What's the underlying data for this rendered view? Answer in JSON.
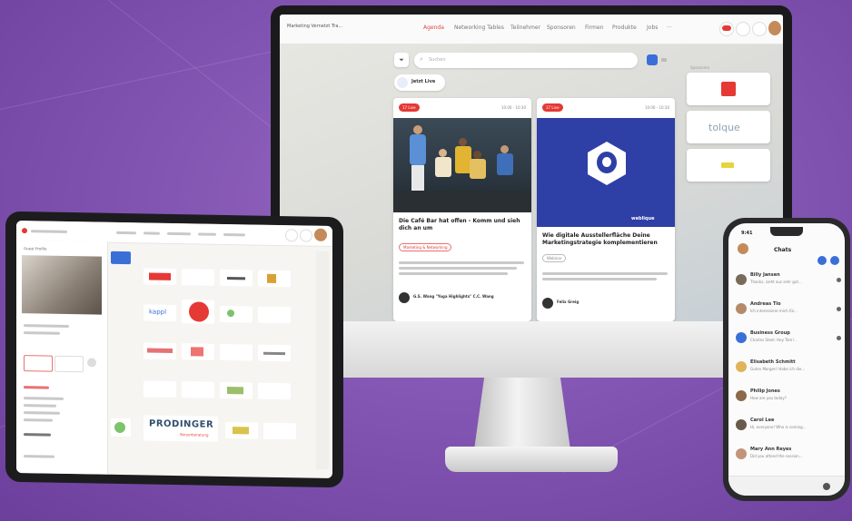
{
  "colors": {
    "background": "#8356b3",
    "accent": "#e53935",
    "primary_blue": "#3b6fd8"
  },
  "desktop": {
    "app_title": "Marketing Vernetzt Tra...",
    "nav_tabs": [
      "Agenda",
      "Networking Tables",
      "Teilnehmer",
      "Sponsoren",
      "Firmen",
      "Produkte",
      "Jobs"
    ],
    "search_placeholder": "Suchen",
    "live_label": "Jetzt Live",
    "cards": [
      {
        "badge": "17 Live",
        "time": "10:00 - 10:30",
        "title": "Die Café Bar hat offen - Komm und sieh dich an um",
        "tag": "Marketing & Networking",
        "speaker": "G.S. Wang \"Yoga Highlights\" C.C. Wang"
      },
      {
        "badge": "17 Live",
        "time": "10:00 - 10:30",
        "title": "Wie digitale Ausstellerfläche Deine Marketingstrategie komplementieren",
        "tag": "Webinar",
        "speaker": "Felix Greig",
        "image_text": "weblique"
      }
    ],
    "sponsors_heading": "Sponsoren",
    "sponsor_logo": "tolque"
  },
  "tablet": {
    "profile_title": "Guest Profile",
    "brand": "PRODINGER",
    "brand_sub": "Steuerberatung",
    "logo_small": "kappl"
  },
  "phone": {
    "time": "9:41",
    "title": "Chats",
    "chats": [
      {
        "name": "Billy Jansen",
        "preview": "Thanks, sieht aus sehr gut..."
      },
      {
        "name": "Andreas Tio",
        "preview": "Ich interessiere mich für..."
      },
      {
        "name": "Business Group",
        "preview": "Charles Steel: Hey Tom!..."
      },
      {
        "name": "Elisabeth Schmitt",
        "preview": "Guten Morgen! Habe ich die..."
      },
      {
        "name": "Philip Jones",
        "preview": "How are you today?"
      },
      {
        "name": "Carol Lee",
        "preview": "Hi, everyone! Who is coming..."
      },
      {
        "name": "Mary Ann Reyes",
        "preview": "Did you attend the session..."
      }
    ]
  }
}
